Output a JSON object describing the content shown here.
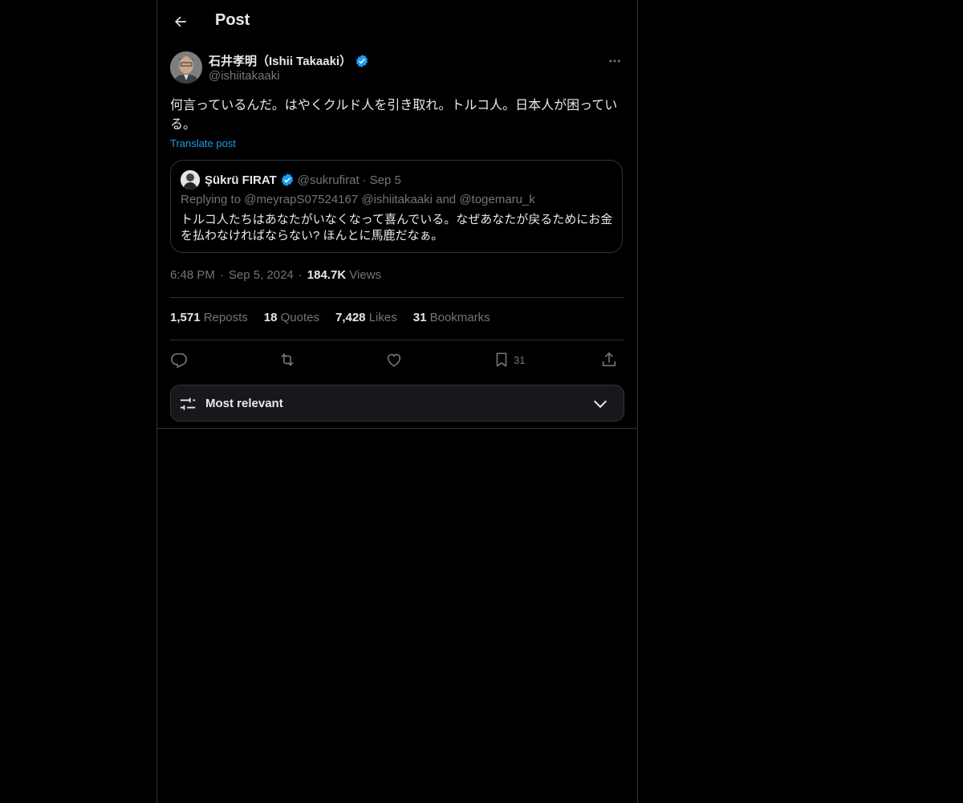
{
  "header": {
    "title": "Post"
  },
  "author": {
    "display_name": "石井孝明（Ishii Takaaki）",
    "handle": "@ishiitakaaki"
  },
  "post": {
    "text": "何言っているんだ。はやくクルド人を引き取れ。トルコ人。日本人が困っている。",
    "translate_label": "Translate post"
  },
  "quote": {
    "name": "Şükrü FIRAT",
    "handle": "@sukrufirat",
    "separator": "·",
    "date": "Sep 5",
    "replying": "Replying to @meyrapS07524167 @ishiitakaaki and @togemaru_k",
    "text": "トルコ人たちはあなたがいなくなって喜んでいる。なぜあなたが戻るためにお金を払わなければならない? ほんとに馬鹿だなぁ。"
  },
  "meta": {
    "time": "6:48 PM",
    "sep": "·",
    "date": "Sep 5, 2024",
    "views_count": "184.7K",
    "views_label": "Views"
  },
  "stats": {
    "reposts_count": "1,571",
    "reposts_label": "Reposts",
    "quotes_count": "18",
    "quotes_label": "Quotes",
    "likes_count": "7,428",
    "likes_label": "Likes",
    "bookmarks_count": "31",
    "bookmarks_label": "Bookmarks"
  },
  "actions": {
    "bookmark_count": "31"
  },
  "sort": {
    "label": "Most relevant"
  },
  "colors": {
    "background": "#000000",
    "text": "#e7e9ea",
    "muted": "#71767b",
    "accent": "#1d9bf0",
    "border": "#2f3336"
  }
}
